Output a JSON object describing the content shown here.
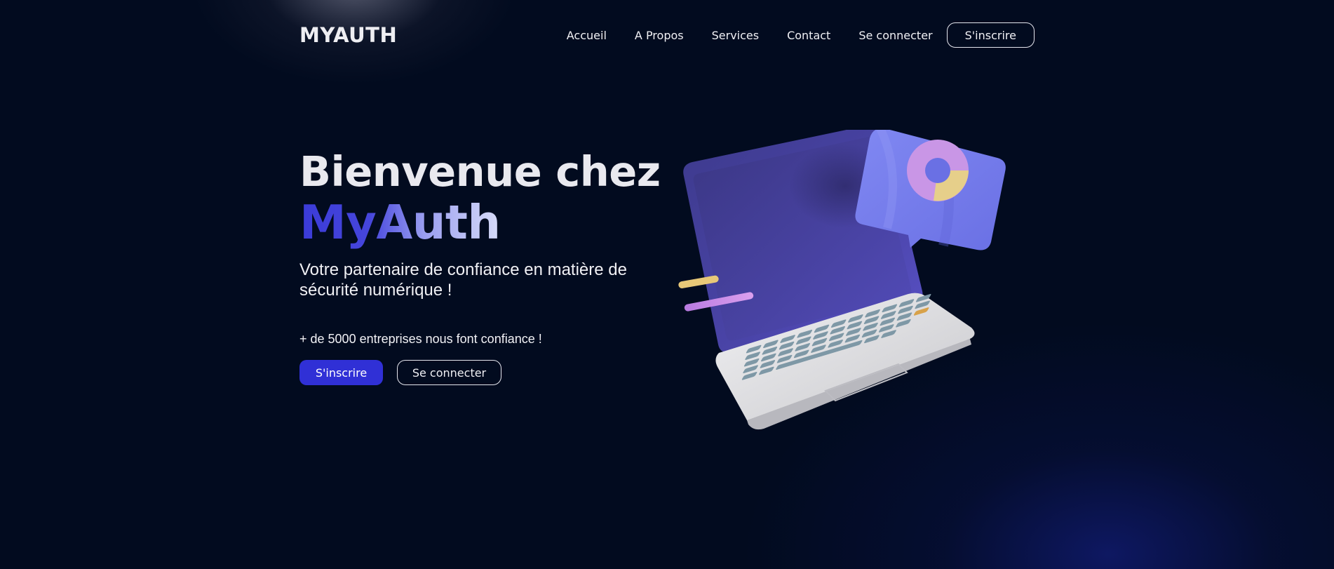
{
  "header": {
    "logo": "MYAUTH",
    "nav": [
      "Accueil",
      "A Propos",
      "Services",
      "Contact",
      "Se connecter"
    ],
    "signup": "S'inscrire"
  },
  "hero": {
    "title": "Bienvenue chez",
    "brand": "MyAuth",
    "subtitle": "Votre partenaire de confiance en matière de sécurité numérique !",
    "trust": "+ de 5000 entreprises nous font confiance !",
    "primary_cta": "S'inscrire",
    "secondary_cta": "Se connecter"
  },
  "illustration": {
    "icon": "laptop-analytics-illustration"
  },
  "colors": {
    "background": "#020b1f",
    "accent": "#3030d6",
    "text": "#e9e9ef"
  }
}
